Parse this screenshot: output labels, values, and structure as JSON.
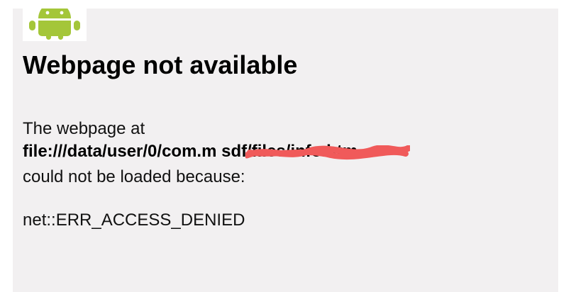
{
  "error_page": {
    "logo_icon": "android-robot-icon",
    "title": "Webpage not available",
    "intro": "The webpage at",
    "url": "file:///data/user/0/com.m                      sdf/files/info.htm",
    "reason_prefix": "could not be loaded because:",
    "error_code": "net::ERR_ACCESS_DENIED"
  },
  "colors": {
    "page_background": "#f2f0f1",
    "android_green": "#a4c639",
    "redaction_red": "#f05a5a"
  }
}
